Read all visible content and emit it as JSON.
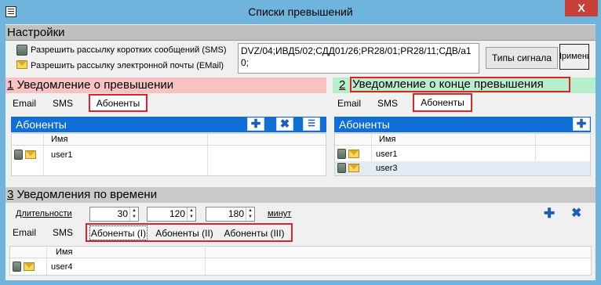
{
  "window": {
    "title": "Списки превышений",
    "close_label": "X"
  },
  "settings": {
    "header": "Настройки",
    "sms_label": "Разрешить рассылку коротких сообщений (SMS)",
    "email_label": "Разрешить рассылку электронной почты (EMail)",
    "controls_text": "DVZ/04;ИВД5/02;СДД01/26;PR28/01;PR28/11;СДВ/a10;",
    "signal_types_button": "Типы сигнала",
    "apply_button": "Применить"
  },
  "notify_exceed": {
    "number": "1",
    "title": " Уведомление о превышении",
    "tabs": [
      "Email",
      "SMS",
      "Абоненты"
    ],
    "list_title": "Абоненты",
    "col_name": "Имя",
    "rows": [
      "user1"
    ]
  },
  "notify_end": {
    "number": "2",
    "title": " Уведомление о конце превышения",
    "tabs": [
      "Email",
      "SMS",
      "Абоненты"
    ],
    "list_title": "Абоненты",
    "col_name": "Имя",
    "rows": [
      "user1",
      "user3"
    ]
  },
  "time_notify": {
    "number": "3",
    "title": " Уведомления по времени",
    "durations_label": "Длительности",
    "durations": [
      "30",
      "120",
      "180"
    ],
    "minutes_label": "минут",
    "tabs": [
      "Email",
      "SMS",
      "Абоненты (I)",
      "Абоненты (II)",
      "Абоненты (III)"
    ],
    "col_name": "Имя",
    "rows": [
      "user4"
    ]
  },
  "icons": {
    "add": "plus-icon",
    "delete": "x-icon",
    "import": "list-icon",
    "sms": "phone-icon",
    "email": "envelope-icon"
  },
  "colors": {
    "frame": "#6fb4dc",
    "close": "#c7403a",
    "list_header": "#0f6fd6",
    "highlight": "#e0232a",
    "exceed_header": "#f8c2c2",
    "end_header": "#b7eecb"
  }
}
